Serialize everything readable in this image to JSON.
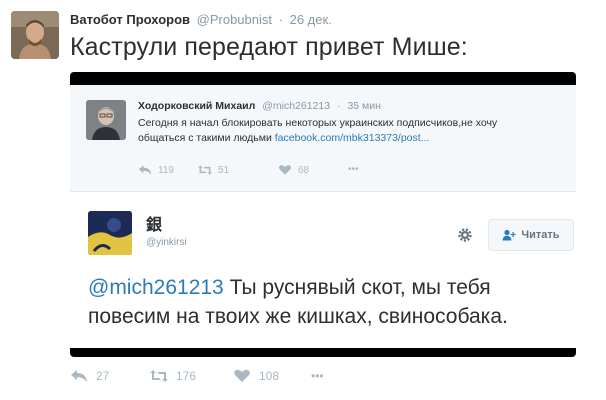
{
  "tweet": {
    "author_name": "Ватобот Прохоров",
    "author_handle": "@Probubnist",
    "separator": "·",
    "time": "26 дек.",
    "text": "Каструли передают привет Мише:",
    "actions": {
      "reply_count": "27",
      "retweet_count": "176",
      "like_count": "108",
      "more": "•••"
    }
  },
  "embedded": {
    "first": {
      "name": "Ходорковский Михаил",
      "handle": "@mich261213",
      "time": "35 мин",
      "text_line1": "Сегодня я начал блокировать некоторых украинских подписчиков,не хочу",
      "text_line2_prefix": "общаться с такими людьми ",
      "link": "facebook.com/mbk313373/post...",
      "reply_count": "119",
      "retweet_count": "51",
      "like_count": "68",
      "more": "•••"
    },
    "second": {
      "name": "銀",
      "handle": "@yinkirsi",
      "follow_label": "Читать",
      "mention": "@mich261213",
      "text_line1_rest": " Ты руснявый скот, мы тебя",
      "text_line2": "повесим на твоих же кишках, свинособака."
    }
  },
  "icons": {
    "avatar": "profile-photo",
    "reply": "reply-icon",
    "retweet": "retweet-icon",
    "like": "heart-icon",
    "more": "more-icon",
    "gear": "gear-icon",
    "follow": "add-user-icon"
  },
  "colors": {
    "link": "#2b7bb9",
    "muted": "#8899a6",
    "icon": "#aab8c2",
    "text": "#292f33"
  }
}
